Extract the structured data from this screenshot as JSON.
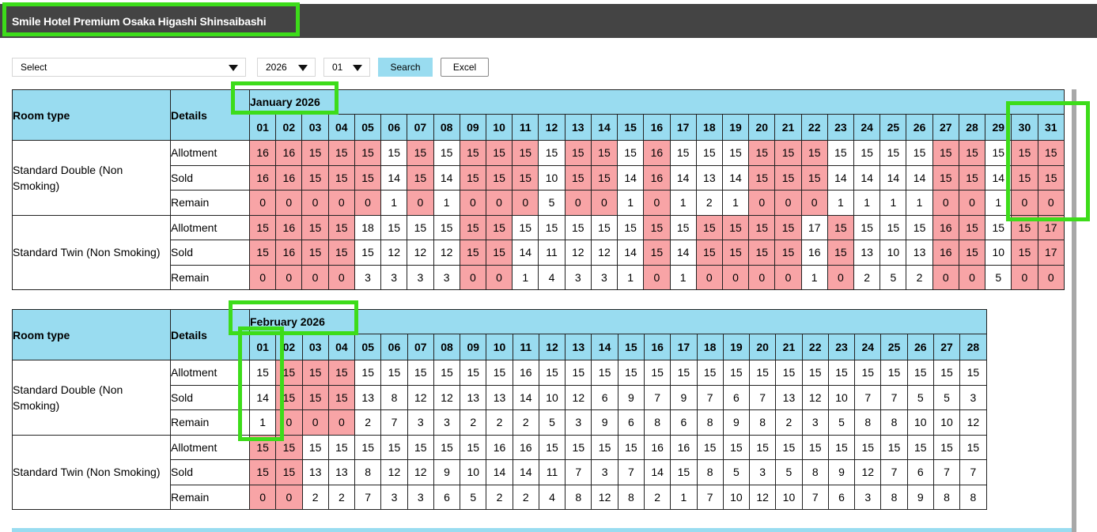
{
  "header": {
    "hotel_name": "Smile Hotel Premium Osaka Higashi Shinsaibashi"
  },
  "toolbar": {
    "room_select": "Select",
    "year": "2026",
    "month": "01",
    "search_label": "Search",
    "excel_label": "Excel"
  },
  "labels": {
    "room_type": "Room type",
    "details": "Details",
    "allotment": "Allotment",
    "sold": "Sold",
    "remain": "Remain"
  },
  "colors": {
    "header_bg": "#444444",
    "table_header": "#99dcf0",
    "sold_out": "#f8a4a6",
    "highlight": "#3ddc1a"
  },
  "months": [
    {
      "title": "January 2026",
      "days": [
        "01",
        "02",
        "03",
        "04",
        "05",
        "06",
        "07",
        "08",
        "09",
        "10",
        "11",
        "12",
        "13",
        "14",
        "15",
        "16",
        "17",
        "18",
        "19",
        "20",
        "21",
        "22",
        "23",
        "24",
        "25",
        "26",
        "27",
        "28",
        "29",
        "30",
        "31"
      ],
      "rooms": [
        {
          "name": "Standard Double (Non Smoking)",
          "allotment": [
            16,
            16,
            15,
            15,
            15,
            15,
            15,
            15,
            15,
            15,
            15,
            15,
            15,
            15,
            15,
            16,
            15,
            15,
            15,
            15,
            15,
            15,
            15,
            15,
            15,
            15,
            15,
            15,
            15,
            15,
            15
          ],
          "sold": [
            16,
            16,
            15,
            15,
            15,
            14,
            15,
            14,
            15,
            15,
            15,
            10,
            15,
            15,
            14,
            16,
            14,
            13,
            14,
            15,
            15,
            15,
            14,
            14,
            14,
            14,
            15,
            15,
            14,
            15,
            15
          ],
          "remain": [
            0,
            0,
            0,
            0,
            0,
            1,
            0,
            1,
            0,
            0,
            0,
            5,
            0,
            0,
            1,
            0,
            1,
            2,
            1,
            0,
            0,
            0,
            1,
            1,
            1,
            1,
            0,
            0,
            1,
            0,
            0
          ]
        },
        {
          "name": "Standard Twin (Non Smoking)",
          "allotment": [
            15,
            16,
            15,
            15,
            18,
            15,
            15,
            15,
            15,
            15,
            15,
            15,
            15,
            15,
            15,
            15,
            15,
            15,
            15,
            15,
            15,
            17,
            15,
            15,
            15,
            15,
            16,
            15,
            15,
            15,
            17
          ],
          "sold": [
            15,
            16,
            15,
            15,
            15,
            12,
            12,
            12,
            15,
            15,
            14,
            11,
            12,
            12,
            14,
            15,
            14,
            15,
            15,
            15,
            15,
            16,
            15,
            13,
            10,
            13,
            16,
            15,
            10,
            15,
            17
          ],
          "remain": [
            0,
            0,
            0,
            0,
            3,
            3,
            3,
            3,
            0,
            0,
            1,
            4,
            3,
            3,
            1,
            0,
            1,
            0,
            0,
            0,
            0,
            1,
            0,
            2,
            5,
            2,
            0,
            0,
            5,
            0,
            0
          ]
        }
      ]
    },
    {
      "title": "February 2026",
      "days": [
        "01",
        "02",
        "03",
        "04",
        "05",
        "06",
        "07",
        "08",
        "09",
        "10",
        "11",
        "12",
        "13",
        "14",
        "15",
        "16",
        "17",
        "18",
        "19",
        "20",
        "21",
        "22",
        "23",
        "24",
        "25",
        "26",
        "27",
        "28"
      ],
      "rooms": [
        {
          "name": "Standard Double (Non Smoking)",
          "allotment": [
            15,
            15,
            15,
            15,
            15,
            15,
            15,
            15,
            15,
            15,
            16,
            15,
            15,
            15,
            15,
            15,
            15,
            15,
            15,
            15,
            15,
            15,
            15,
            15,
            15,
            15,
            15,
            15
          ],
          "sold": [
            14,
            15,
            15,
            15,
            13,
            8,
            12,
            12,
            13,
            13,
            14,
            10,
            12,
            6,
            9,
            7,
            9,
            7,
            6,
            7,
            13,
            12,
            10,
            7,
            7,
            5,
            5,
            3
          ],
          "remain": [
            1,
            0,
            0,
            0,
            2,
            7,
            3,
            3,
            2,
            2,
            2,
            5,
            3,
            9,
            6,
            8,
            6,
            8,
            9,
            8,
            2,
            3,
            5,
            8,
            8,
            10,
            10,
            12
          ]
        },
        {
          "name": "Standard Twin (Non Smoking)",
          "allotment": [
            15,
            15,
            15,
            15,
            15,
            15,
            15,
            15,
            15,
            16,
            16,
            15,
            15,
            15,
            15,
            16,
            16,
            15,
            15,
            15,
            15,
            15,
            15,
            15,
            15,
            15,
            15,
            15
          ],
          "sold": [
            15,
            15,
            13,
            13,
            8,
            12,
            12,
            9,
            10,
            14,
            14,
            11,
            7,
            3,
            7,
            14,
            15,
            8,
            5,
            3,
            5,
            8,
            9,
            12,
            7,
            6,
            7,
            7
          ],
          "remain": [
            0,
            0,
            2,
            2,
            7,
            3,
            3,
            6,
            5,
            2,
            2,
            4,
            8,
            12,
            8,
            2,
            1,
            7,
            10,
            12,
            10,
            7,
            6,
            3,
            8,
            9,
            8,
            8
          ]
        }
      ]
    }
  ]
}
